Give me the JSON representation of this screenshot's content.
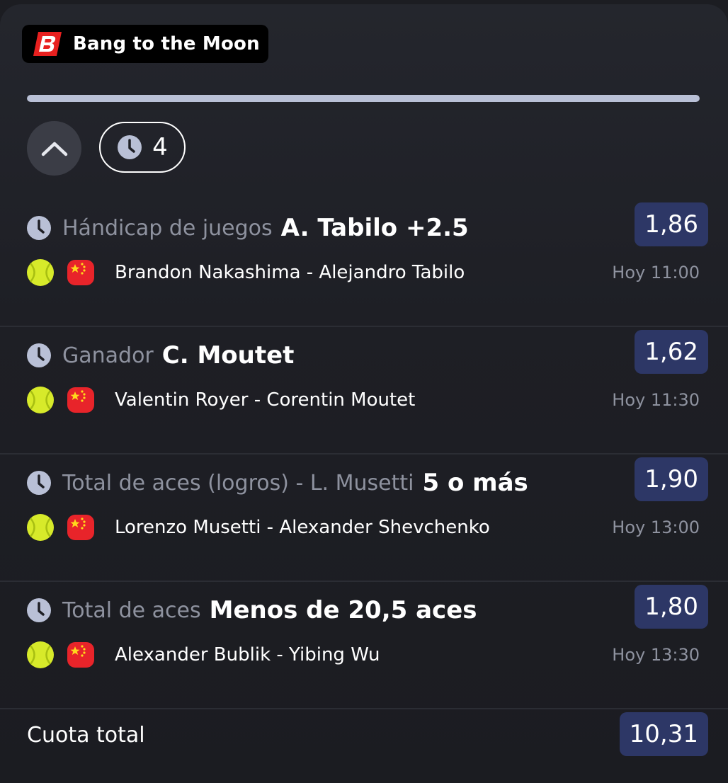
{
  "brand": {
    "name": "Bang to the Moon",
    "logo_icon": "bang-b-logo"
  },
  "header": {
    "progress_fraction": 1.0,
    "collapse_icon": "chevron-up-icon",
    "pending_count": "4",
    "pending_icon": "clock-icon"
  },
  "colors": {
    "odds_bg": "#2d3766",
    "muted_text": "#8e929f",
    "progress_fill": "#b9c0d6"
  },
  "bets": [
    {
      "market": "Hándicap de juegos",
      "pick": "A. Tabilo +2.5",
      "odds": "1,86",
      "event": "Brandon Nakashima - Alejandro Tabilo",
      "time": "Hoy 11:00"
    },
    {
      "market": "Ganador",
      "pick": "C. Moutet",
      "odds": "1,62",
      "event": "Valentin Royer - Corentin Moutet",
      "time": "Hoy 11:30"
    },
    {
      "market": "Total de aces (logros) - L. Musetti",
      "pick": "5 o más",
      "odds": "1,90",
      "event": "Lorenzo Musetti - Alexander Shevchenko",
      "time": "Hoy 13:00"
    },
    {
      "market": "Total de aces",
      "pick": "Menos de 20,5 aces",
      "odds": "1,80",
      "event": "Alexander Bublik - Yibing Wu",
      "time": "Hoy 13:30"
    }
  ],
  "total": {
    "label": "Cuota total",
    "odds": "10,31"
  }
}
